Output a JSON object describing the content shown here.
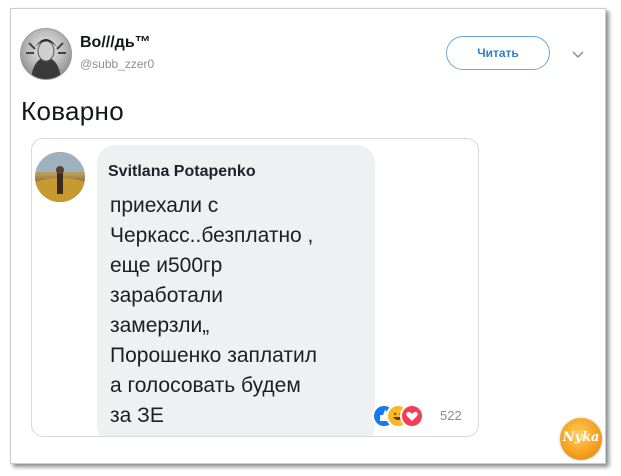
{
  "tweet": {
    "author_name": "Во///дь™",
    "author_handle": "@subb_zzer0",
    "follow_label": "Читать",
    "text": "Коварно"
  },
  "embedded_post": {
    "author": "Svitlana Potapenko",
    "lines": [
      "приехали с",
      "Черкасс..безплатно ,",
      "еще и500гр",
      "заработали",
      "замерзли„",
      "Порошенко заплатил",
      "а голосовать будем",
      "за ЗЕ"
    ],
    "reaction_count": "522",
    "reactions": [
      "like-icon",
      "haha-icon",
      "love-icon"
    ]
  },
  "watermark": {
    "text": "Nyka"
  },
  "colors": {
    "accent": "#2f80c4",
    "bubble": "#eff0f2",
    "like": "#1877f2",
    "haha": "#f7b928",
    "love": "#f33e58"
  }
}
